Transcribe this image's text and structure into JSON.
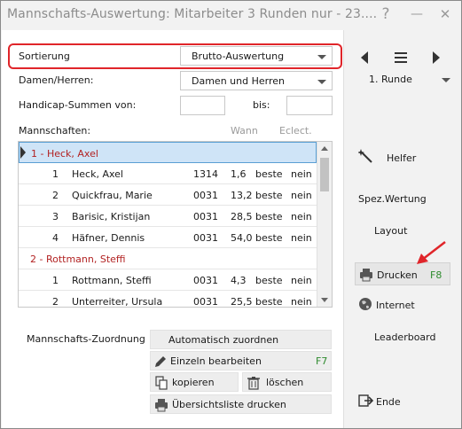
{
  "window": {
    "title": "Mannschafts-Auswertung: Mitarbeiter 3 Runden nur - 23....",
    "help_label": "?",
    "minimize_label": "—",
    "close_label": "✕"
  },
  "form": {
    "sort_label": "Sortierung",
    "sort_value": "Brutto-Auswertung",
    "gender_label": "Damen/Herren:",
    "gender_value": "Damen und Herren",
    "handicap_label": "Handicap-Summen von:",
    "handicap_from": "",
    "handicap_to_label": "bis:",
    "handicap_to": "",
    "teams_label": "Mannschaften:",
    "col_wann": "Wann",
    "col_eclect": "Eclect."
  },
  "teams": {
    "group1": "1 - Heck, Axel",
    "group2": "2 - Rottmann, Steffi",
    "rows": [
      {
        "pos": "1",
        "name": "Heck, Axel",
        "id": "1314",
        "value": "1,6",
        "wann": "beste",
        "eclect": "nein"
      },
      {
        "pos": "2",
        "name": "Quickfrau, Marie",
        "id": "0031",
        "value": "13,2",
        "wann": "beste",
        "eclect": "nein"
      },
      {
        "pos": "3",
        "name": "Barisic, Kristijan",
        "id": "0031",
        "value": "28,5",
        "wann": "beste",
        "eclect": "nein"
      },
      {
        "pos": "4",
        "name": "Häfner, Dennis",
        "id": "0031",
        "value": "54,0",
        "wann": "beste",
        "eclect": "nein"
      },
      {
        "pos": "1",
        "name": "Rottmann, Steffi",
        "id": "0031",
        "value": "4,3",
        "wann": "beste",
        "eclect": "nein"
      },
      {
        "pos": "2",
        "name": "Unterreiter, Ursula",
        "id": "0031",
        "value": "25,5",
        "wann": "beste",
        "eclect": "nein"
      }
    ]
  },
  "assignment": {
    "label": "Mannschafts-Zuordnung",
    "auto": "Automatisch zuordnen",
    "edit": "Einzeln bearbeiten",
    "edit_hotkey": "F7",
    "copy": "kopieren",
    "delete": "löschen",
    "print_overview": "Übersichtsliste drucken"
  },
  "sidebar": {
    "round_value": "1. Runde",
    "helper": "Helfer",
    "special_scoring": "Spez.Wertung",
    "layout": "Layout",
    "print": "Drucken",
    "print_hotkey": "F8",
    "internet": "Internet",
    "leaderboard": "Leaderboard",
    "exit": "Ende"
  },
  "colors": {
    "accent_red": "#e0252a",
    "selection": "#cfe4f7",
    "group_text": "#b22222",
    "hotkey": "#2e8b2e"
  }
}
